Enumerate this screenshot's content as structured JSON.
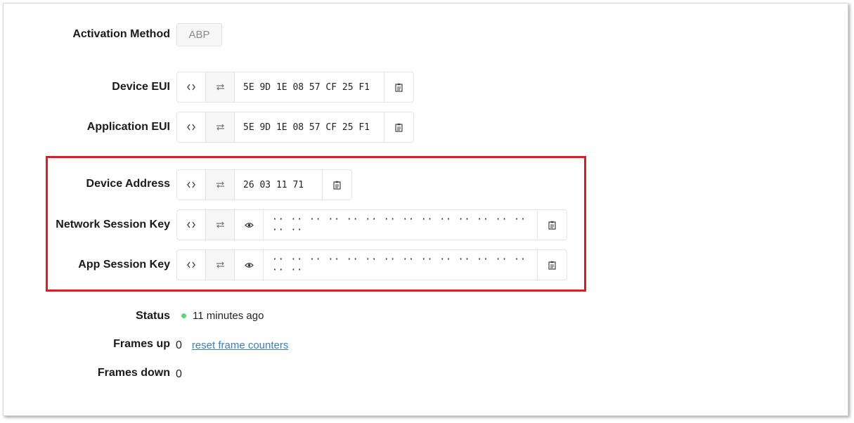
{
  "activation": {
    "label": "Activation Method",
    "value": "ABP"
  },
  "device_eui": {
    "label": "Device EUI",
    "value": "5E 9D 1E 08 57 CF 25 F1"
  },
  "application_eui": {
    "label": "Application EUI",
    "value": "5E 9D 1E 08 57 CF 25 F1"
  },
  "device_address": {
    "label": "Device Address",
    "value": "26 03 11 71"
  },
  "network_session_key": {
    "label": "Network Session Key",
    "value": "·· ·· ·· ·· ·· ·· ·· ·· ·· ·· ·· ·· ·· ·· ·· ··"
  },
  "app_session_key": {
    "label": "App Session Key",
    "value": "·· ·· ·· ·· ·· ·· ·· ·· ·· ·· ·· ·· ·· ·· ·· ··"
  },
  "status": {
    "label": "Status",
    "value": "11 minutes ago",
    "color": "#5fd27a"
  },
  "frames_up": {
    "label": "Frames up",
    "value": "0",
    "reset_link": "reset frame counters"
  },
  "frames_down": {
    "label": "Frames down",
    "value": "0"
  },
  "highlight_color": "#e01b24"
}
